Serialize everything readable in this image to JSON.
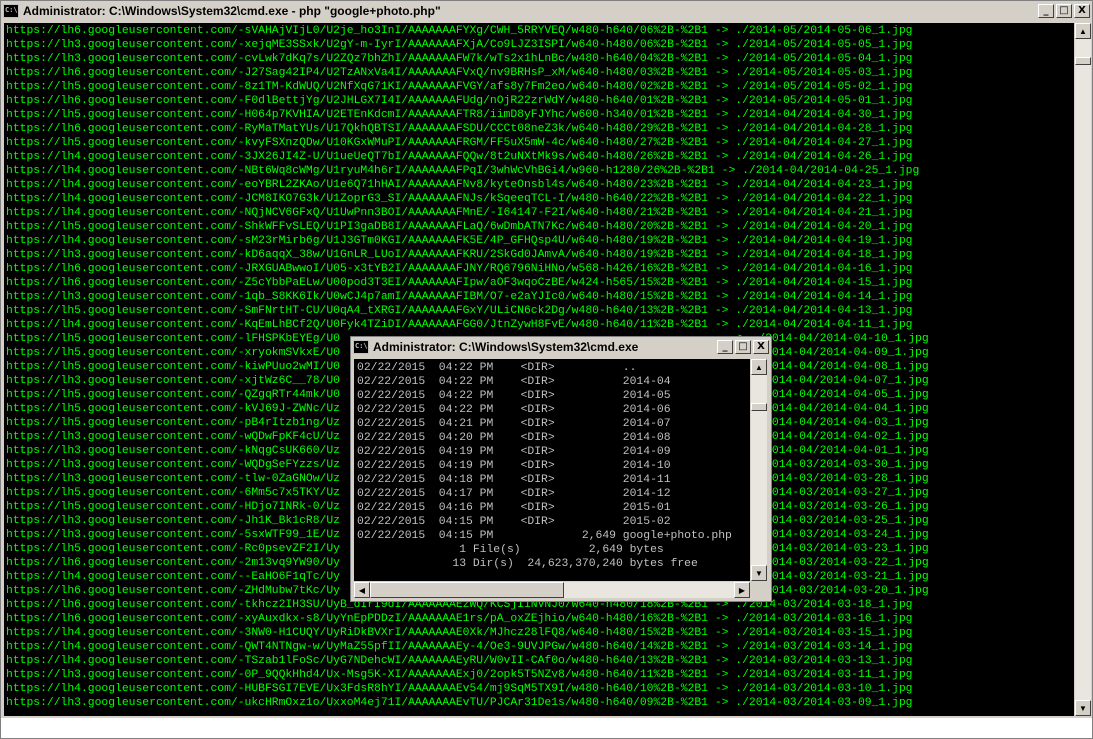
{
  "colors": {
    "console_fg_main": "#00ff00",
    "console_fg_front": "#c0c0c0",
    "console_bg": "#000000",
    "titlebar_inactive": "#d4d0c8"
  },
  "main_window": {
    "title": "Administrator: C:\\Windows\\System32\\cmd.exe - php  \"google+photo.php\"",
    "icon_text": "C:\\",
    "buttons": {
      "minimize": "_",
      "maximize": "□",
      "close": "X"
    },
    "lines": [
      "https://lh6.googleusercontent.com/-sVAHAjVIjL0/U2je_ho3InI/AAAAAAAFYXg/CWH_5RRYVEQ/w480-h640/06%2B-%2B1 -> ./2014-05/2014-05-06_1.jpg",
      "https://lh3.googleusercontent.com/-xejqME3SSxk/U2gY-m-IyrI/AAAAAAAFXjA/Co9LJZ3ISPI/w640-h480/06%2B-%2B1 -> ./2014-05/2014-05-05_1.jpg",
      "https://lh3.googleusercontent.com/-cvLwk7dKq7s/U2ZQz7bhZhI/AAAAAAAFW7k/wTs2x1hLnBc/w480-h640/04%2B-%2B1 -> ./2014-05/2014-05-04_1.jpg",
      "https://lh6.googleusercontent.com/-J27Sag42IP4/U2TzANxVa4I/AAAAAAAFVxQ/nv9BRHsP_xM/w640-h480/03%2B-%2B1 -> ./2014-05/2014-05-03_1.jpg",
      "https://lh5.googleusercontent.com/-8z1TM-KdWUQ/U2NfXqG71KI/AAAAAAAFVGY/afs8y7Fm2eo/w640-h480/02%2B-%2B1 -> ./2014-05/2014-05-02_1.jpg",
      "https://lh6.googleusercontent.com/-F0dlBettjYg/U2JHLGX7I4I/AAAAAAAFUdg/nOjR22zrWdY/w480-h640/01%2B-%2B1 -> ./2014-05/2014-05-01_1.jpg",
      "https://lh5.googleusercontent.com/-H064p7KVHIA/U2ETEnKdcmI/AAAAAAAFTR8/iimD8yFJYhc/w600-h340/01%2B-%2B1 -> ./2014-04/2014-04-30_1.jpg",
      "https://lh6.googleusercontent.com/-RyMaTMatYUs/U17QkhQBTSI/AAAAAAAFSDU/CCCt08neZ3k/w640-h480/29%2B-%2B1 -> ./2014-04/2014-04-28_1.jpg",
      "https://lh5.googleusercontent.com/-kvyFSXnzQDw/U10KGxWMuPI/AAAAAAAFRGM/FF5uX5mW-4c/w640-h480/27%2B-%2B1 -> ./2014-04/2014-04-27_1.jpg",
      "https://lh4.googleusercontent.com/-3JX26JI4Z-U/U1ueUeQT7bI/AAAAAAAFQQw/8t2uNXtMk9s/w640-h480/26%2B-%2B1 -> ./2014-04/2014-04-26_1.jpg",
      "https://lh4.googleusercontent.com/-NBt6Wq8cWMg/U1ryuM4h6rI/AAAAAAAFPqI/3whWcVhBGi4/w960-h1280/26%2B-%2B1 -> ./2014-04/2014-04-25_1.jpg",
      "https://lh4.googleusercontent.com/-eoYBRL2ZKAo/U1e6Q71hHAI/AAAAAAAFNv8/kyteOnsbl4s/w640-h480/23%2B-%2B1 -> ./2014-04/2014-04-23_1.jpg",
      "https://lh4.googleusercontent.com/-JCM8IKO7G3k/U1ZoprG3_SI/AAAAAAAFNJs/kSqeeqTCL-I/w480-h640/22%2B-%2B1 -> ./2014-04/2014-04-22_1.jpg",
      "https://lh4.googleusercontent.com/-NQjNCV6GFxQ/U1UwPnn3BOI/AAAAAAAFMnE/-I64147-F2I/w640-h480/21%2B-%2B1 -> ./2014-04/2014-04-21_1.jpg",
      "https://lh5.googleusercontent.com/-ShkWFFvSLEQ/U1PI3gaDB8I/AAAAAAAFLaQ/6wDmbATN7Kc/w640-h480/20%2B-%2B1 -> ./2014-04/2014-04-20_1.jpg",
      "https://lh4.googleusercontent.com/-sM23rMirb6g/U1J3GTm0KGI/AAAAAAAFK5E/4P_GFHQsp4U/w640-h480/19%2B-%2B1 -> ./2014-04/2014-04-19_1.jpg",
      "https://lh3.googleusercontent.com/-kD6aqqX_38w/U1GnLR_LUoI/AAAAAAAFKRU/2SkGd0JAmvA/w640-h480/19%2B-%2B1 -> ./2014-04/2014-04-18_1.jpg",
      "https://lh6.googleusercontent.com/-JRXGUABwwoI/U05-x3tYB2I/AAAAAAAFJNY/RQ6796NiHNo/w568-h426/16%2B-%2B1 -> ./2014-04/2014-04-16_1.jpg",
      "https://lh6.googleusercontent.com/-Z5cYbbPaELw/U00pod3T3EI/AAAAAAAFIpw/aOF3wqoCzBE/w424-h565/15%2B-%2B1 -> ./2014-04/2014-04-15_1.jpg",
      "https://lh3.googleusercontent.com/-1qb_S8KK6Ik/U0wCJ4p7amI/AAAAAAAFIBM/O7-e2aYJIc0/w640-h480/15%2B-%2B1 -> ./2014-04/2014-04-14_1.jpg",
      "https://lh5.googleusercontent.com/-SmFNrtHT-CU/U0qA4_tXRGI/AAAAAAAFGxY/ULiCN6ck2Dg/w480-h640/13%2B-%2B1 -> ./2014-04/2014-04-13_1.jpg",
      "https://lh4.googleusercontent.com/-KqEmLhBCf2Q/U0Fyk4TZiDI/AAAAAAAFGG0/JtnZywH8FvE/w480-h640/11%2B-%2B1 -> ./2014-04/2014-04-11_1.jpg",
      "https://lh5.googleusercontent.com/-lFHSPKbEYEg/U0",
      "https://lh5.googleusercontent.com/-xryokmSVkxE/U0",
      "https://lh5.googleusercontent.com/-kiwPUuo2wMI/U0",
      "https://lh3.googleusercontent.com/-xjtWz6C__78/U0",
      "https://lh5.googleusercontent.com/-QZgqRTr44mk/U0",
      "https://lh5.googleusercontent.com/-kVJ69J-ZWNc/Uz",
      "https://lh5.googleusercontent.com/-pB4rItzb1ng/Uz",
      "https://lh3.googleusercontent.com/-wQDwFpKF4cU/Uz",
      "https://lh3.googleusercontent.com/-kNqgCsUK660/Uz",
      "https://lh3.googleusercontent.com/-WQDgSeFYzzs/Uz",
      "https://lh3.googleusercontent.com/-tlw-0ZaGNOw/Uz",
      "https://lh5.googleusercontent.com/-6Mm5c7x5TKY/Uz",
      "https://lh5.googleusercontent.com/-HDjo7INRk-0/Uz",
      "https://lh3.googleusercontent.com/-Jh1K_Bk1cR8/Uz",
      "https://lh3.googleusercontent.com/-5sxWTF99_1E/Uz",
      "https://lh5.googleusercontent.com/-Rc0psevZF2I/Uy",
      "https://lh6.googleusercontent.com/-2m13vq9YW90/Uy",
      "https://lh4.googleusercontent.com/--EaHO6F1qTc/Uy",
      "https://lh6.googleusercontent.com/-ZHdMubw7tKc/Uy",
      "https://lh6.googleusercontent.com/-tkhcz2IH3SU/UyB_dIrI9dI/AAAAAAAEzWQ/KCSjIiNVNJ0/w640-h480/18%2B-%2B1 -> ./2014-03/2014-03-18_1.jpg",
      "https://lh6.googleusercontent.com/-xyAuxdkx-s8/UyYnEpPDDzI/AAAAAAAE1rs/pA_oxZEjhio/w640-h480/16%2B-%2B1 -> ./2014-03/2014-03-16_1.jpg",
      "https://lh4.googleusercontent.com/-3NW0-H1CUQY/UyRiDkBVXrI/AAAAAAAE0Xk/MJhcz28lFQ8/w640-h480/15%2B-%2B1 -> ./2014-03/2014-03-15_1.jpg",
      "https://lh4.googleusercontent.com/-QWT4NTNgw-w/UyMaZ55pfII/AAAAAAAEy-4/Oe3-9UVJPGw/w480-h640/14%2B-%2B1 -> ./2014-03/2014-03-14_1.jpg",
      "https://lh4.googleusercontent.com/-TSzab1lFoSc/UyG7NDehcWI/AAAAAAAEyRU/W0vII-CAf0o/w480-h640/13%2B-%2B1 -> ./2014-03/2014-03-13_1.jpg",
      "https://lh3.googleusercontent.com/-0P_9QQkHhd4/Ux-Msg5K-XI/AAAAAAAExj0/2opk5T5NZv8/w480-h640/11%2B-%2B1 -> ./2014-03/2014-03-11_1.jpg",
      "https://lh4.googleusercontent.com/-HUBFSGI7EVE/Ux3FdsR8hYI/AAAAAAAEv54/mj9SqM5TX9I/w480-h640/10%2B-%2B1 -> ./2014-03/2014-03-10_1.jpg",
      "https://lh3.googleusercontent.com/-ukcHRmOxz1o/UxxoM4ej71I/AAAAAAAEvTU/PJCAr31De1s/w480-h640/09%2B-%2B1 -> ./2014-03/2014-03-09_1.jpg"
    ],
    "right_tails": [
      {
        "row": 22,
        "text": "-> ./2014-04/2014-04-10_1.jpg"
      },
      {
        "row": 23,
        "text": "-> ./2014-04/2014-04-09_1.jpg"
      },
      {
        "row": 24,
        "text": "-> ./2014-04/2014-04-08_1.jpg"
      },
      {
        "row": 25,
        "text": "-> ./2014-04/2014-04-07_1.jpg"
      },
      {
        "row": 26,
        "text": "-> ./2014-04/2014-04-05_1.jpg"
      },
      {
        "row": 27,
        "text": "-> ./2014-04/2014-04-04_1.jpg"
      },
      {
        "row": 28,
        "text": "-> ./2014-04/2014-04-03_1.jpg"
      },
      {
        "row": 29,
        "text": "-> ./2014-04/2014-04-02_1.jpg"
      },
      {
        "row": 30,
        "text": "-> ./2014-04/2014-04-01_1.jpg"
      },
      {
        "row": 31,
        "text": "-> ./2014-03/2014-03-30_1.jpg"
      },
      {
        "row": 32,
        "text": "-> ./2014-03/2014-03-28_1.jpg"
      },
      {
        "row": 33,
        "text": "-> ./2014-03/2014-03-27_1.jpg"
      },
      {
        "row": 34,
        "text": "-> ./2014-03/2014-03-26_1.jpg"
      },
      {
        "row": 35,
        "text": "-> ./2014-03/2014-03-25_1.jpg"
      },
      {
        "row": 36,
        "text": "-> ./2014-03/2014-03-24_1.jpg"
      },
      {
        "row": 37,
        "text": "-> ./2014-03/2014-03-23_1.jpg"
      },
      {
        "row": 38,
        "text": "-> ./2014-03/2014-03-22_1.jpg"
      },
      {
        "row": 39,
        "text": "-> ./2014-03/2014-03-21_1.jpg"
      },
      {
        "row": 40,
        "text": "-> ./2014-03/2014-03-20_1.jpg"
      }
    ]
  },
  "front_window": {
    "title": "Administrator: C:\\Windows\\System32\\cmd.exe",
    "icon_text": "C:\\",
    "buttons": {
      "minimize": "_",
      "maximize": "□",
      "close": "X"
    },
    "lines": [
      "02/22/2015  04:22 PM    <DIR>          ..",
      "02/22/2015  04:22 PM    <DIR>          2014-04",
      "02/22/2015  04:22 PM    <DIR>          2014-05",
      "02/22/2015  04:22 PM    <DIR>          2014-06",
      "02/22/2015  04:21 PM    <DIR>          2014-07",
      "02/22/2015  04:20 PM    <DIR>          2014-08",
      "02/22/2015  04:19 PM    <DIR>          2014-09",
      "02/22/2015  04:19 PM    <DIR>          2014-10",
      "02/22/2015  04:18 PM    <DIR>          2014-11",
      "02/22/2015  04:17 PM    <DIR>          2014-12",
      "02/22/2015  04:16 PM    <DIR>          2015-01",
      "02/22/2015  04:15 PM    <DIR>          2015-02",
      "02/22/2015  04:15 PM             2,649 google+photo.php",
      "               1 File(s)          2,649 bytes",
      "              13 Dir(s)  24,623,370,240 bytes free"
    ]
  }
}
